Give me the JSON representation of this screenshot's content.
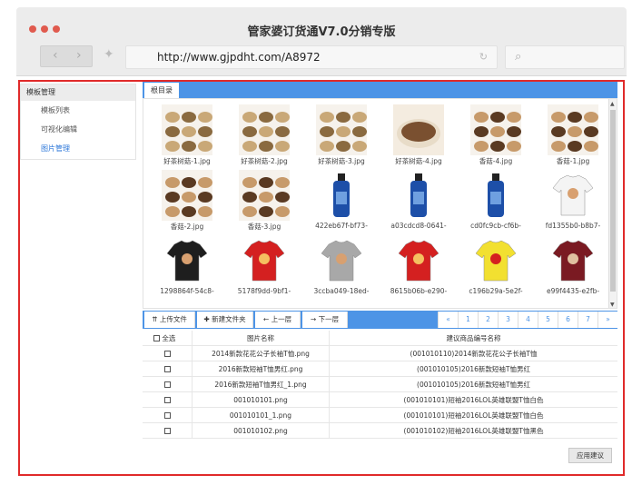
{
  "window": {
    "title": "管家婆订货通V7.0分销专版",
    "url": "http://www.gjpdht.com/A8972"
  },
  "sidebar": {
    "header": "模板管理",
    "items": [
      {
        "label": "模板列表"
      },
      {
        "label": "可视化编辑"
      },
      {
        "label": "图片管理"
      }
    ]
  },
  "gallery": {
    "tab": "根目录",
    "images": [
      {
        "name": "好茶树菇-1.jpg",
        "kind": "mushroom-a"
      },
      {
        "name": "好茶树菇-2.jpg",
        "kind": "mushroom-a"
      },
      {
        "name": "好茶树菇-3.jpg",
        "kind": "mushroom-a"
      },
      {
        "name": "好茶树菇-4.jpg",
        "kind": "soup"
      },
      {
        "name": "香菇-4.jpg",
        "kind": "shiitake"
      },
      {
        "name": "香菇-1.jpg",
        "kind": "shiitake"
      },
      {
        "name": "香菇-2.jpg",
        "kind": "shiitake"
      },
      {
        "name": "香菇-3.jpg",
        "kind": "shiitake"
      },
      {
        "name": "422eb67f-bf73-",
        "kind": "bottle"
      },
      {
        "name": "a03cdcd8-0641-",
        "kind": "bottle"
      },
      {
        "name": "cd0fc9cb-cf6b-",
        "kind": "bottle"
      },
      {
        "name": "fd1355b0-b8b7-",
        "kind": "shirt-white"
      },
      {
        "name": "1298864f-54c8-",
        "kind": "shirt-black"
      },
      {
        "name": "5178f9dd-9bf1-",
        "kind": "shirt-red"
      },
      {
        "name": "3ccba049-18ed-",
        "kind": "shirt-grey"
      },
      {
        "name": "8615b06b-e290-",
        "kind": "shirt-red"
      },
      {
        "name": "c196b29a-5e2f-",
        "kind": "shirt-yellow"
      },
      {
        "name": "e99f4435-e2fb-",
        "kind": "shirt-maroon"
      }
    ]
  },
  "toolbar": {
    "upload": "上传文件",
    "new_folder": "新建文件夹",
    "up_level": "上一层",
    "down_level": "下一层"
  },
  "pager": [
    "«",
    "1",
    "2",
    "3",
    "4",
    "5",
    "6",
    "7",
    "»"
  ],
  "table": {
    "headers": {
      "select_all": "全选",
      "image_name": "图片名称",
      "suggested_code": "建议商品编号名称"
    },
    "rows": [
      {
        "name": "2014新款花花公子长袖T恤.png",
        "code": "(001010110)2014新款花花公子长袖T恤"
      },
      {
        "name": "2016新款短袖T恤男红.png",
        "code": "(001010105)2016新款短袖T恤男红"
      },
      {
        "name": "2016新款短袖T恤男红_1.png",
        "code": "(001010105)2016新款短袖T恤男红"
      },
      {
        "name": "001010101.png",
        "code": "(001010101)短袖2016LOL英雄联盟T恤白色"
      },
      {
        "name": "001010101_1.png",
        "code": "(001010101)短袖2016LOL英雄联盟T恤白色"
      },
      {
        "name": "001010102.png",
        "code": "(001010102)短袖2016LOL英雄联盟T恤黑色"
      }
    ]
  },
  "apply_button": "应用建议",
  "colors": {
    "accent": "#4d94e6",
    "highlight_border": "#e02a2a",
    "traffic_light": "#e05a4e"
  }
}
